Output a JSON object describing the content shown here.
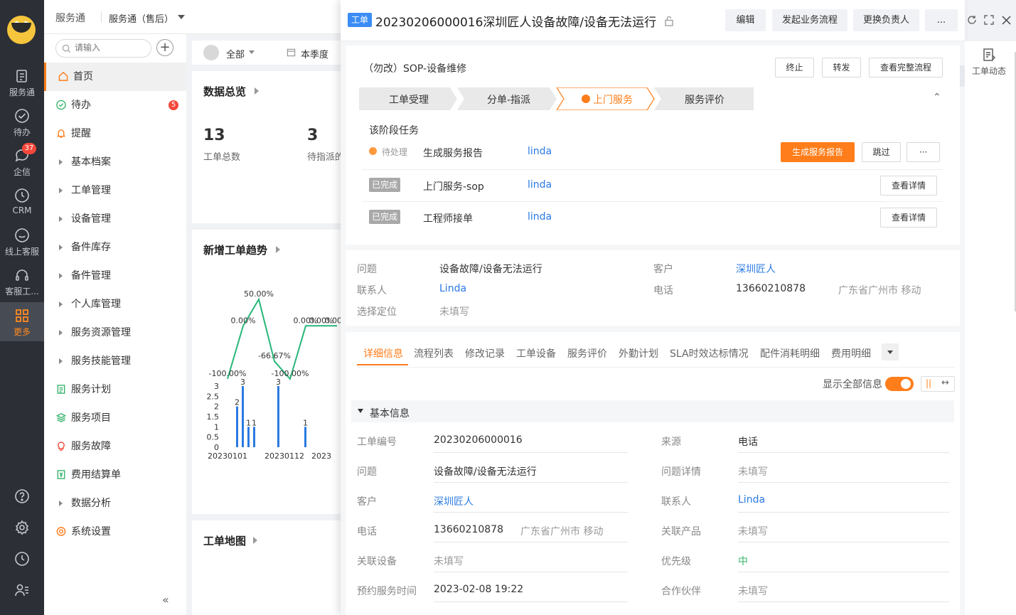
{
  "rail": {
    "items": [
      {
        "label": "服务通"
      },
      {
        "label": "待办"
      },
      {
        "label": "企信",
        "badge": "37"
      },
      {
        "label": "CRM"
      },
      {
        "label": "线上客服"
      },
      {
        "label": "客服工..."
      },
      {
        "label": "更多"
      }
    ]
  },
  "topbar": {
    "app": "服务通",
    "workspace": "服务通（售后）"
  },
  "sidebar": {
    "search_placeholder": "请输入",
    "items": [
      {
        "label": "首页",
        "icon": "home-icon"
      },
      {
        "label": "待办",
        "icon": "check-circle-icon",
        "badge": "5"
      },
      {
        "label": "提醒",
        "icon": "bell-icon"
      },
      {
        "label": "基本档案"
      },
      {
        "label": "工单管理"
      },
      {
        "label": "设备管理"
      },
      {
        "label": "备件库存"
      },
      {
        "label": "备件管理"
      },
      {
        "label": "个人库管理"
      },
      {
        "label": "服务资源管理"
      },
      {
        "label": "服务技能管理"
      },
      {
        "label": "服务计划",
        "icon": "plan-icon"
      },
      {
        "label": "服务项目",
        "icon": "layers-icon"
      },
      {
        "label": "服务故障",
        "icon": "bulb-icon"
      },
      {
        "label": "费用结算单",
        "icon": "yen-icon"
      },
      {
        "label": "数据分析"
      },
      {
        "label": "系统设置",
        "icon": "gear-icon"
      }
    ],
    "collapse": "«"
  },
  "dashboard": {
    "filter_all": "全部",
    "filter_period": "本季度",
    "overview_title": "数据总览",
    "stats": [
      {
        "value": "13",
        "label": "工单总数"
      },
      {
        "value": "3",
        "label": "待指派的"
      }
    ],
    "trend_title": "新增工单趋势",
    "map_title": "工单地图"
  },
  "chart_data": {
    "type": "bar",
    "title": "新增工单趋势",
    "line_series": {
      "labels": [
        "-100.00%",
        "0.00%",
        "50.00%",
        "-66.67%",
        "-100.00%",
        "0.00%",
        "0.00%",
        "0.00%"
      ],
      "values": [
        -100,
        0,
        50,
        -66.67,
        -100,
        0,
        0,
        0
      ]
    },
    "bar_series": {
      "values": [
        2,
        3,
        1,
        1,
        3,
        1
      ]
    },
    "y_ticks": [
      "0",
      "0.5",
      "1",
      "1.5",
      "2",
      "2.5",
      "3"
    ],
    "x_ticks": [
      "20230101",
      "20230112",
      "2023"
    ],
    "ylim": [
      0,
      3
    ]
  },
  "detail": {
    "tag": "工单",
    "title": "20230206000016深圳匠人设备故障/设备无法运行",
    "buttons": [
      "编辑",
      "发起业务流程",
      "更换负责人",
      "..."
    ],
    "sop_title": "（勿改）SOP-设备维修",
    "sop_buttons": [
      "终止",
      "转发",
      "查看完整流程"
    ],
    "steps": [
      "工单受理",
      "分单-指派",
      "上门服务",
      "服务评价"
    ],
    "tasks_heading": "该阶段任务",
    "tasks": [
      {
        "status": "待处理",
        "name": "生成服务报告",
        "owner": "linda",
        "primary": "生成服务报告",
        "secondary": "跳过",
        "more": "···"
      },
      {
        "status": "已完成",
        "name": "上门服务-sop",
        "owner": "linda",
        "action": "查看详情"
      },
      {
        "status": "已完成",
        "name": "工程师接单",
        "owner": "linda",
        "action": "查看详情"
      }
    ],
    "summary": {
      "problem_label": "问题",
      "problem": "设备故障/设备无法运行",
      "customer_label": "客户",
      "customer": "深圳匠人",
      "contact_label": "联系人",
      "contact": "Linda",
      "phone_label": "电话",
      "phone": "13660210878",
      "location": "广东省广州市 移动",
      "locate_label": "选择定位",
      "locate": "未填写"
    },
    "tabs": [
      "详细信息",
      "流程列表",
      "修改记录",
      "工单设备",
      "服务评价",
      "外勤计划",
      "SLA时效达标情况",
      "配件消耗明细",
      "费用明细"
    ],
    "show_all_label": "显示全部信息",
    "section_title": "基本信息",
    "fields_left": [
      {
        "label": "工单编号",
        "value": "20230206000016"
      },
      {
        "label": "问题",
        "value": "设备故障/设备无法运行"
      },
      {
        "label": "客户",
        "value": "深圳匠人"
      },
      {
        "label": "电话",
        "value": "13660210878",
        "extra": "广东省广州市 移动"
      },
      {
        "label": "关联设备",
        "value": "未填写"
      },
      {
        "label": "预约服务时间",
        "value": "2023-02-08 19:22"
      }
    ],
    "fields_right": [
      {
        "label": "来源",
        "value": "电话"
      },
      {
        "label": "问题详情",
        "value": "未填写"
      },
      {
        "label": "联系人",
        "value": "Linda"
      },
      {
        "label": "关联产品",
        "value": "未填写"
      },
      {
        "label": "优先级",
        "value": "中"
      },
      {
        "label": "合作伙伴",
        "value": "未填写"
      }
    ]
  },
  "right_rail": {
    "label": "工单动态"
  },
  "colors": {
    "accent": "#ff7d1a",
    "link": "#2a7ae2",
    "rail": "#2c2f36",
    "tag": "#3b8cf5",
    "success": "#3bb46f"
  }
}
